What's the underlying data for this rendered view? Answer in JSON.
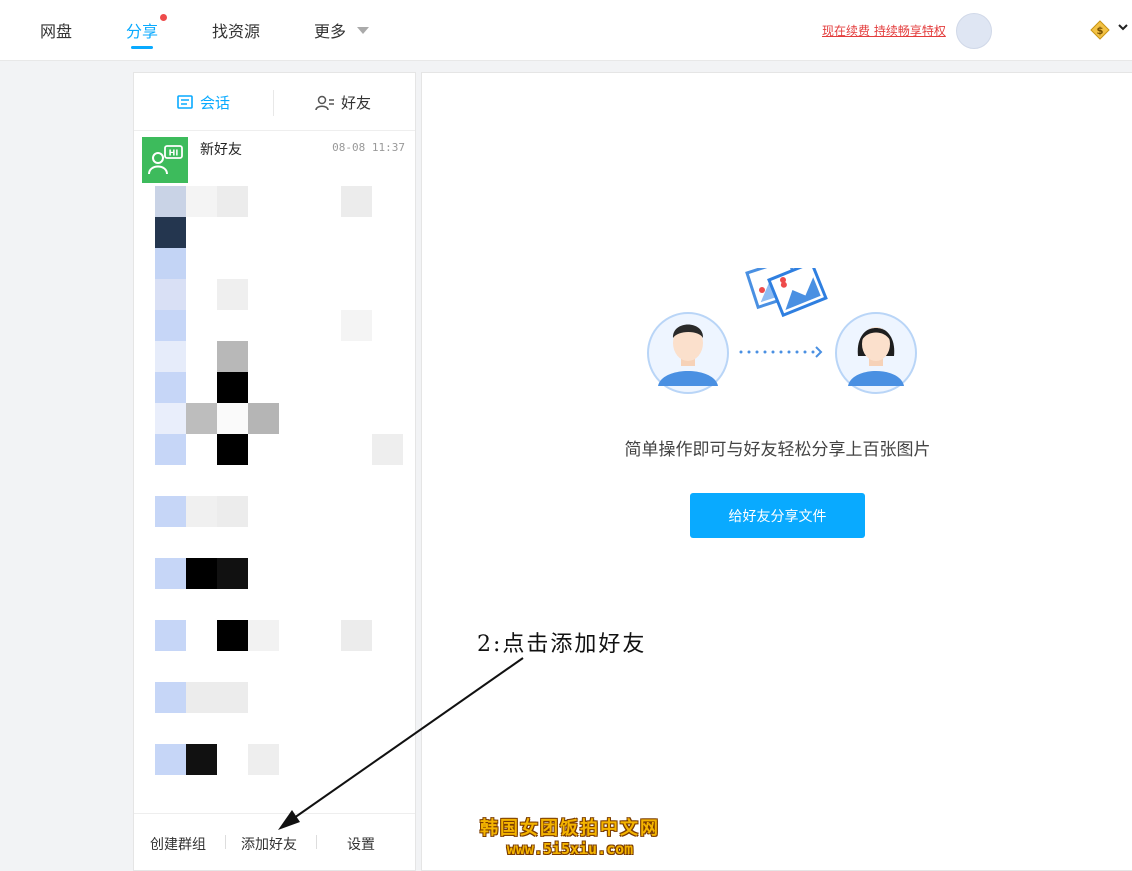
{
  "nav": {
    "items": [
      {
        "label": "网盘"
      },
      {
        "label": "分享"
      },
      {
        "label": "找资源"
      },
      {
        "label": "更多"
      }
    ],
    "renew_link": "现在续费 持续畅享特权"
  },
  "left_panel": {
    "tabs": [
      {
        "label": "会话"
      },
      {
        "label": "好友"
      }
    ],
    "first_conversation": {
      "name": "新好友",
      "time": "08-08 11:37"
    },
    "bottom": {
      "create_group": "创建群组",
      "add_friend": "添加好友",
      "settings": "设置"
    }
  },
  "main": {
    "promo_text": "简单操作即可与好友轻松分享上百张图片",
    "share_button": "给好友分享文件"
  },
  "annotation": {
    "text": "2:点击添加好友"
  },
  "watermark": {
    "line1": "韩国女团饭拍中文网",
    "line2": "www.5i5xiu.com"
  },
  "colors": {
    "accent": "#09aaff",
    "new_friend_avatar": "#3dbb5c",
    "renew_link": "#e33c3c"
  }
}
